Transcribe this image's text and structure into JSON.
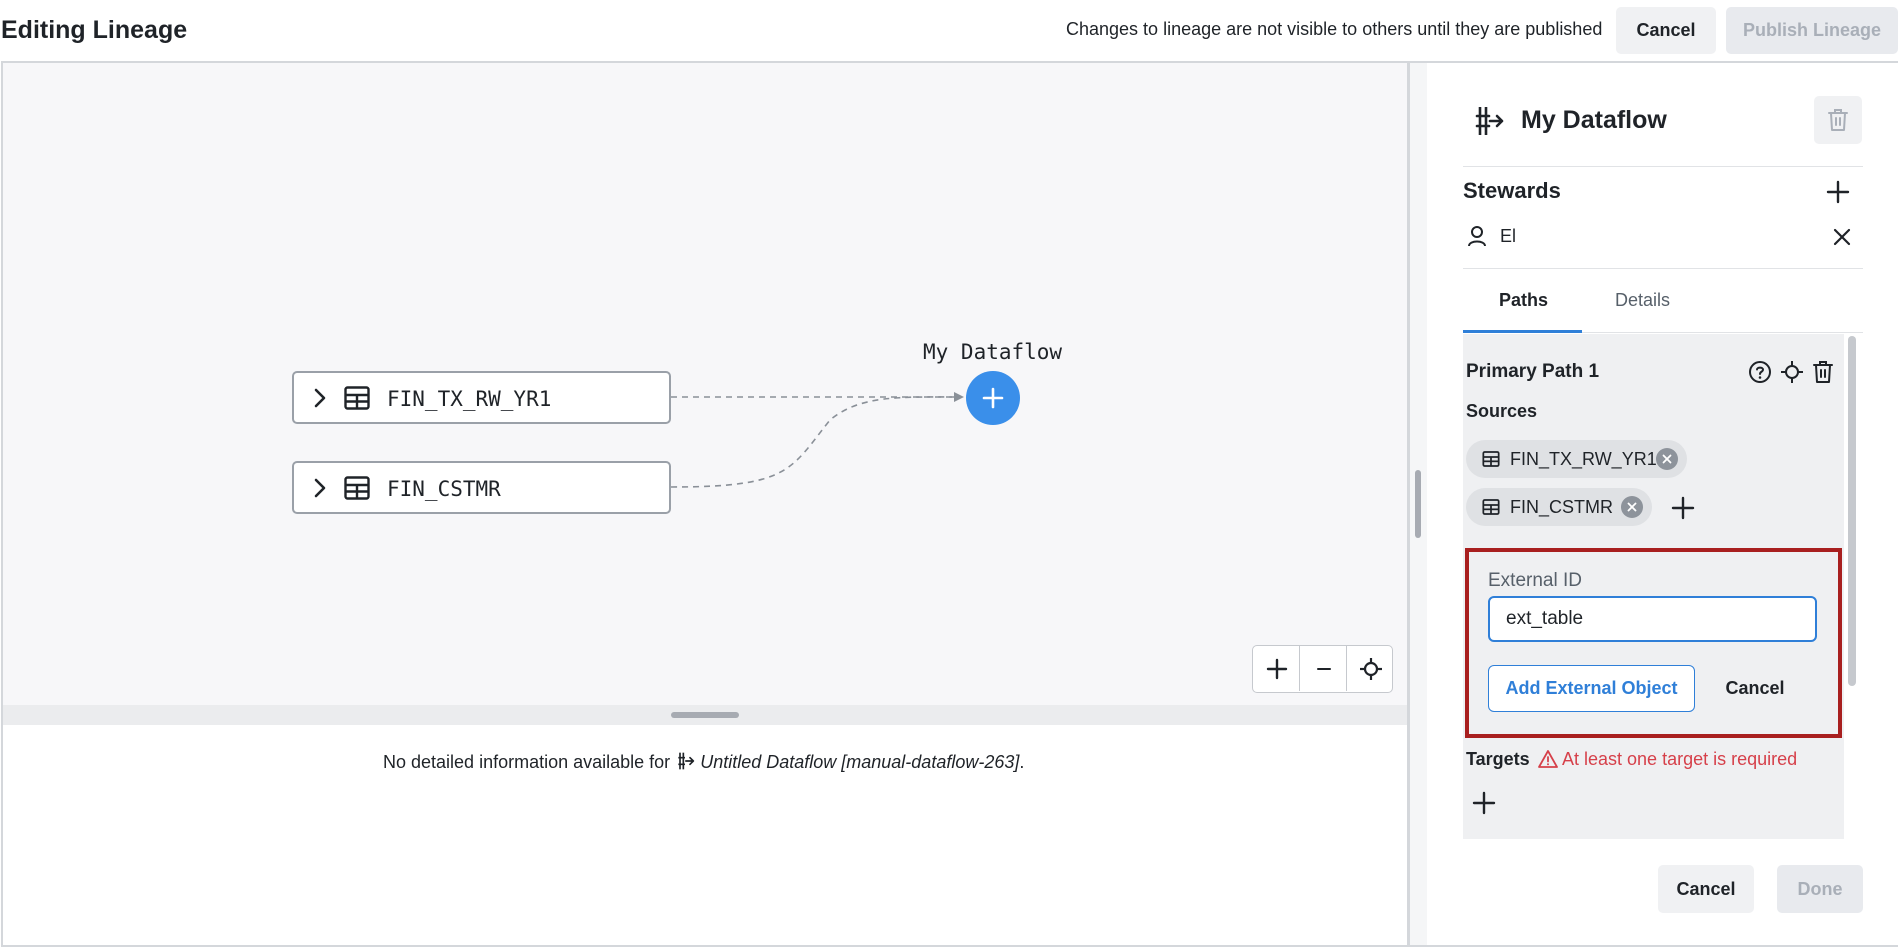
{
  "header": {
    "title": "Editing Lineage",
    "note": "Changes to lineage are not visible to others until they are published",
    "cancel_label": "Cancel",
    "publish_label": "Publish Lineage"
  },
  "graph": {
    "nodes": [
      {
        "label": "FIN_TX_RW_YR1",
        "icon": "table-icon"
      },
      {
        "label": "FIN_CSTMR",
        "icon": "table-icon"
      }
    ],
    "dataflow": {
      "label": "My Dataflow",
      "icon": "plus-icon",
      "color": "#3a8fea"
    },
    "zoom_controls": [
      "zoom-in-icon",
      "zoom-out-icon",
      "recenter-icon"
    ]
  },
  "details": {
    "prefix": "No detailed information available for",
    "dataflow_name": "Untitled Dataflow [manual-dataflow-263]",
    "suffix": "."
  },
  "panel": {
    "title": "My Dataflow",
    "stewards_label": "Stewards",
    "stewards": [
      {
        "name": "El",
        "icon": "user-icon"
      }
    ],
    "tabs": [
      {
        "label": "Paths",
        "active": true
      },
      {
        "label": "Details",
        "active": false
      }
    ],
    "path": {
      "title": "Primary Path 1",
      "sources_label": "Sources",
      "sources": [
        {
          "label": "FIN_TX_RW_YR1",
          "icon": "table-icon"
        },
        {
          "label": "FIN_CSTMR",
          "icon": "table-icon"
        }
      ],
      "external": {
        "label": "External ID",
        "value": "ext_table",
        "add_label": "Add External Object",
        "cancel_label": "Cancel",
        "highlight_color": "#a81f1f"
      },
      "targets_label": "Targets",
      "targets_warning": "At least one target is required",
      "warning_color": "#d6404a"
    },
    "cancel_label": "Cancel",
    "done_label": "Done",
    "accent_color": "#2f7fd8"
  }
}
